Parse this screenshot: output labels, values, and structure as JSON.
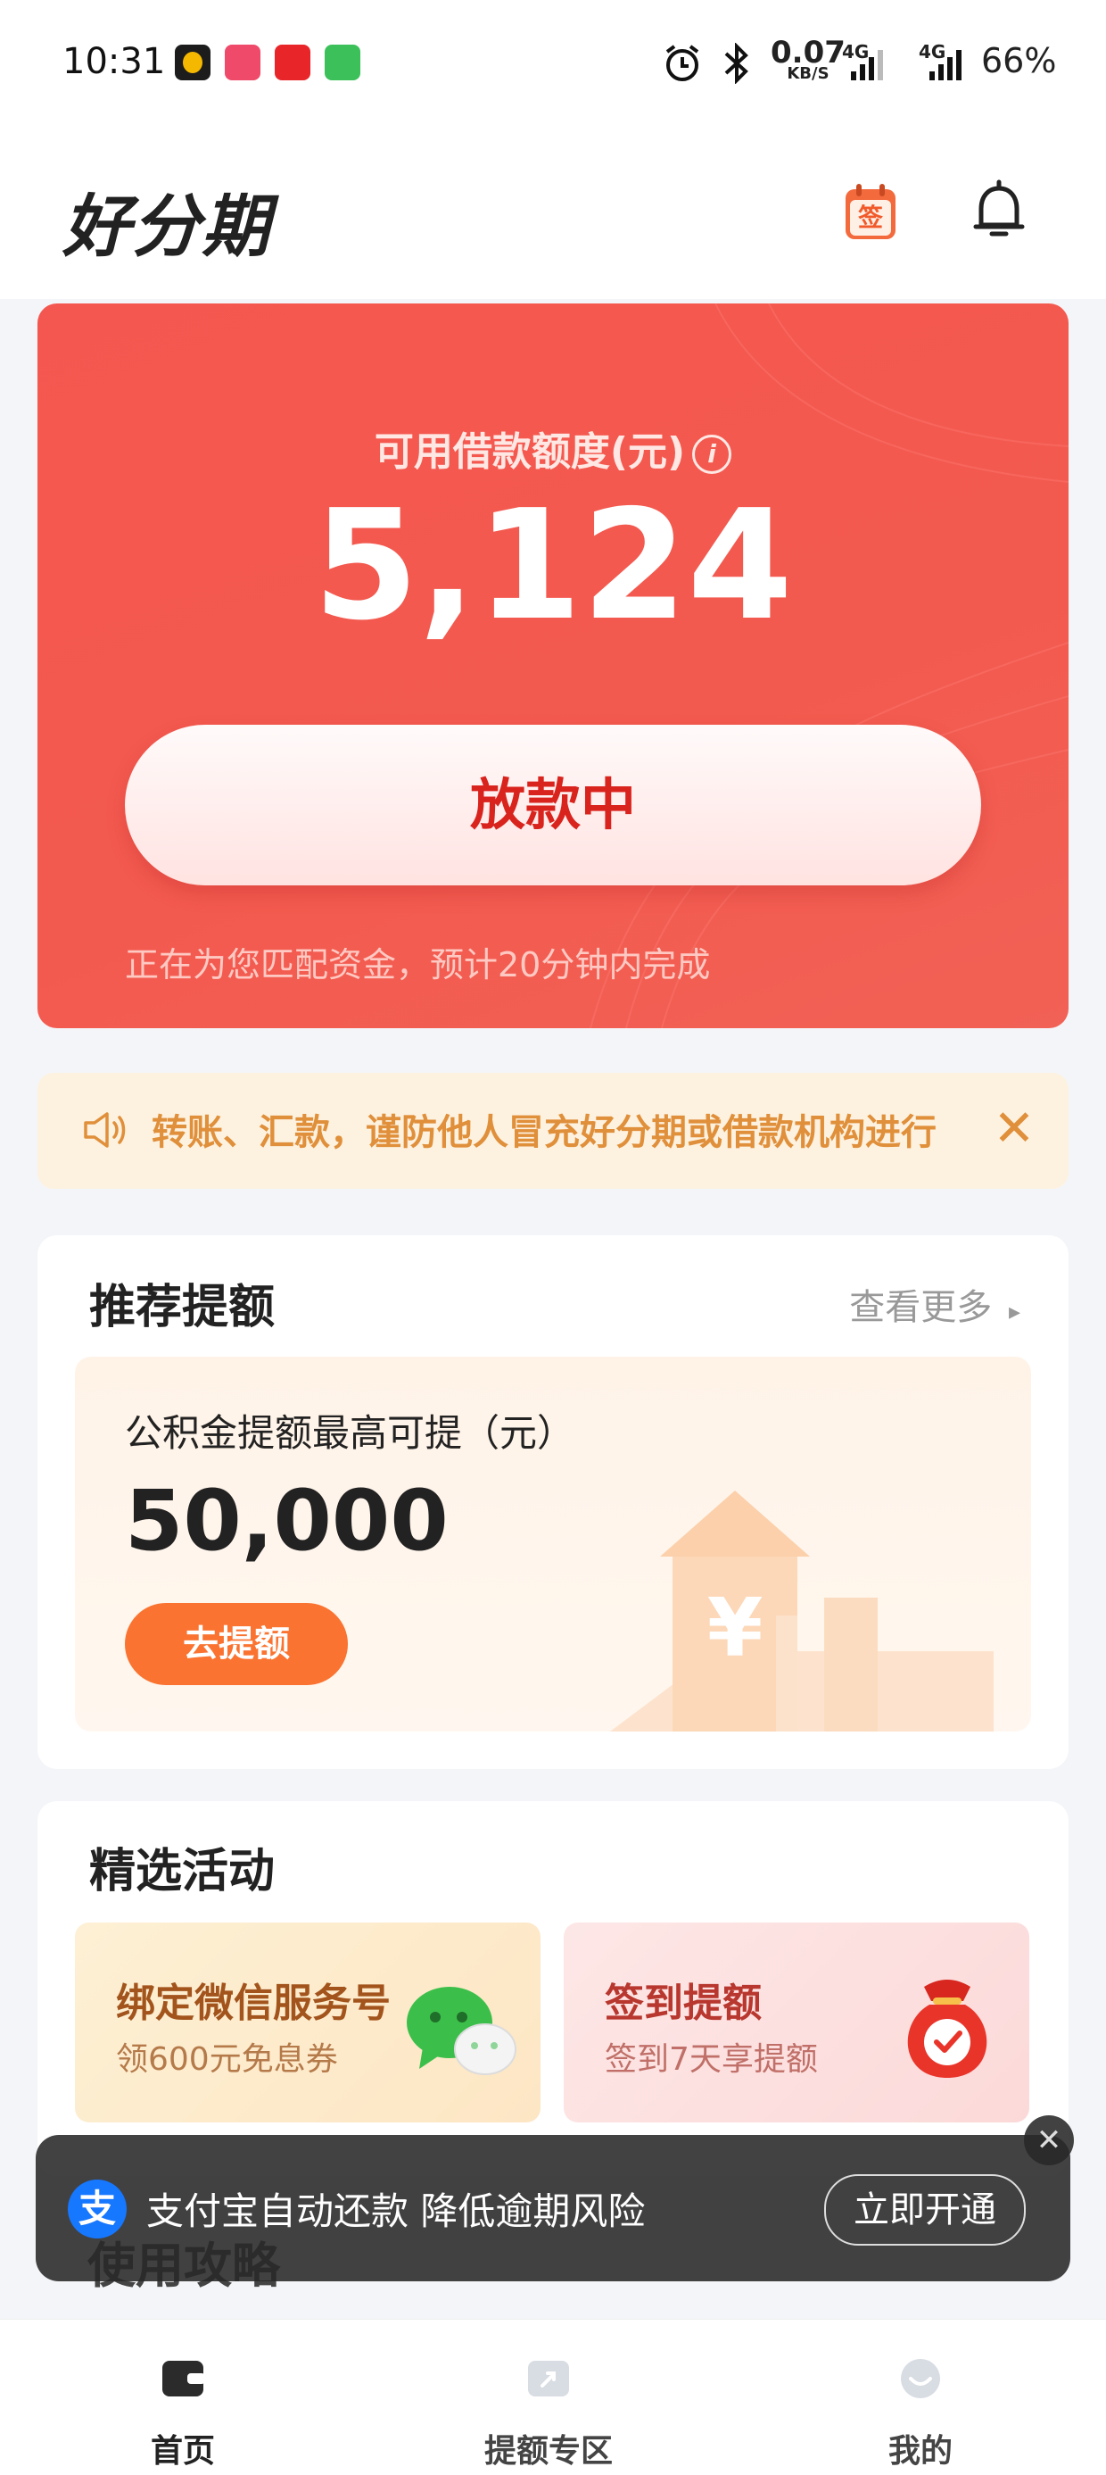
{
  "status_bar": {
    "time": "10:31",
    "net_speed": "0.07",
    "net_unit": "KB/S",
    "signal1": "4G",
    "signal2": "4G",
    "battery": "66%",
    "app_icons": [
      "app-icon-1",
      "app-icon-2",
      "app-icon-3",
      "app-icon-4"
    ]
  },
  "header": {
    "logo": "好分期",
    "icons": [
      "calendar-sign-icon",
      "bell-icon"
    ],
    "calendar_char": "签"
  },
  "credit": {
    "label": "可用借款额度(元)",
    "amount": "5,124",
    "status_button": "放款中",
    "subtitle": "正在为您匹配资金，预计20分钟内完成"
  },
  "notice": {
    "text": "转账、汇款，谨防他人冒充好分期或借款机构进行",
    "close": "✕"
  },
  "recommend": {
    "title": "推荐提额",
    "more": "查看更多",
    "card_label": "公积金提额最高可提（元）",
    "amount": "50,000",
    "button": "去提额"
  },
  "activities": {
    "title": "精选活动",
    "items": [
      {
        "title": "绑定微信服务号",
        "subtitle": "领600元免息券",
        "icon": "wechat-icon"
      },
      {
        "title": "签到提额",
        "subtitle": "签到7天享提额",
        "icon": "red-bag-icon"
      }
    ]
  },
  "guide": {
    "title": "使用攻略"
  },
  "alipay_bar": {
    "icon_char": "支",
    "text": "支付宝自动还款 降低逾期风险",
    "button": "立即开通",
    "close": "✕"
  },
  "bottom_nav": [
    {
      "label": "首页",
      "icon": "wallet-icon",
      "active": true
    },
    {
      "label": "提额专区",
      "icon": "boost-icon",
      "active": false
    },
    {
      "label": "我的",
      "icon": "profile-icon",
      "active": false
    }
  ],
  "colors": {
    "brand_red": "#f4574f",
    "button_text_red": "#d9231d",
    "orange_button": "#fa7330",
    "notice_bg": "#fdf2e0",
    "notice_text": "#e08f3a",
    "alipay_blue": "#1677ff"
  }
}
